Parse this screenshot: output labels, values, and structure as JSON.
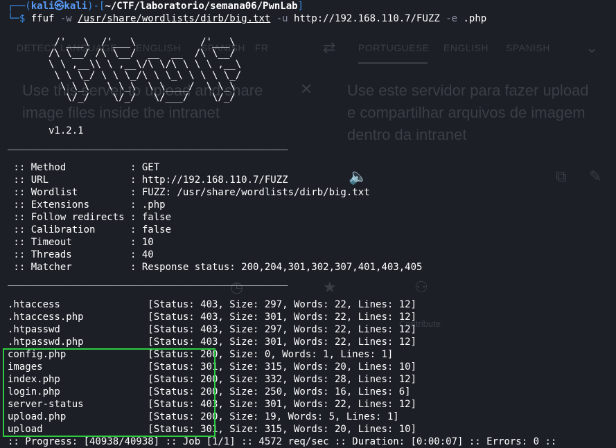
{
  "ghost": {
    "tabs": [
      "DETECT LANGUAGE",
      "ENGLISH",
      "SPANISH",
      "FR",
      "PORTUGUESE",
      "ENGLISH",
      "SPANISH"
    ],
    "source_text": "Use this server to upload and share\nimage files inside the intranet",
    "target_text": "Use este servidor para fazer upload\ne compartilhar arquivos de imagem\ndentro da intranet",
    "contribute": "Contribute"
  },
  "prompt": {
    "open": "┌──(",
    "user": "kali㉿kali",
    "mid": ")-[",
    "path": "~/CTF/laboratorio/semana06/PwnLab",
    "close": "]",
    "corner": "└─",
    "dollar": "$ ",
    "cmd": "ffuf",
    "flag_w": " -w ",
    "wordlist": "/usr/share/wordlists/dirb/big.txt",
    "flag_u": " -u ",
    "url": "http://192.168.110.7/FUZZ",
    "flag_e": " -e ",
    "ext": ".php"
  },
  "banner": {
    "ascii": "        /'___\\  /'___\\           /'___\\\n       /\\ \\__/ /\\ \\__/  __  __  /\\ \\__/\n       \\ \\ ,__\\\\ \\ ,__\\/\\ \\/\\ \\ \\ \\ ,__\\\n        \\ \\ \\_/ \\ \\ \\_/\\ \\ \\_\\ \\ \\ \\ \\_/\n         \\ \\_\\   \\ \\_\\  \\ \\____/  \\ \\_\\\n          \\/_/    \\/_/   \\/___/    \\/_/",
    "version": "       v1.2.1"
  },
  "separator": "________________________________________________",
  "config": [
    " :: Method           : GET",
    " :: URL              : http://192.168.110.7/FUZZ",
    " :: Wordlist         : FUZZ: /usr/share/wordlists/dirb/big.txt",
    " :: Extensions       : .php",
    " :: Follow redirects : false",
    " :: Calibration      : false",
    " :: Timeout          : 10",
    " :: Threads          : 40",
    " :: Matcher          : Response status: 200,204,301,302,307,401,403,405"
  ],
  "results": [
    ".htaccess               [Status: 403, Size: 297, Words: 22, Lines: 12]",
    ".htaccess.php           [Status: 403, Size: 301, Words: 22, Lines: 12]",
    ".htpasswd               [Status: 403, Size: 297, Words: 22, Lines: 12]",
    ".htpasswd.php           [Status: 403, Size: 301, Words: 22, Lines: 12]",
    "config.php              [Status: 200, Size: 0, Words: 1, Lines: 1]",
    "images                  [Status: 301, Size: 315, Words: 20, Lines: 10]",
    "index.php               [Status: 200, Size: 332, Words: 28, Lines: 12]",
    "login.php               [Status: 200, Size: 250, Words: 16, Lines: 6]",
    "server-status           [Status: 403, Size: 301, Words: 22, Lines: 12]",
    "upload.php              [Status: 200, Size: 19, Words: 5, Lines: 1]",
    "upload                  [Status: 301, Size: 315, Words: 20, Lines: 10]"
  ],
  "progress": ":: Progress: [40938/40938] :: Job [1/1] :: 4572 req/sec :: Duration: [0:00:07] :: Errors: 0 ::",
  "colors": {
    "background": "#1c1f26",
    "prompt": "#3b8eea",
    "highlight": "#2ecc40"
  }
}
